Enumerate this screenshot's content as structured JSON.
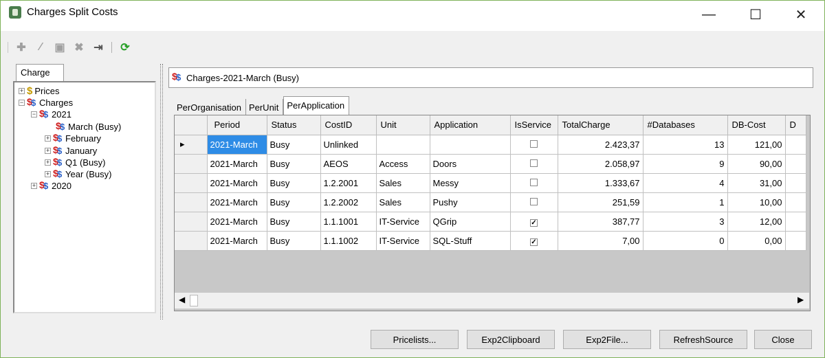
{
  "window": {
    "title": "Charges Split Costs",
    "minimize": "—",
    "maximize": "☐",
    "close": "✕"
  },
  "toolbar": {
    "icons": [
      "add-icon",
      "edit-icon",
      "save-icon",
      "delete-icon",
      "export-icon",
      "refresh-icon"
    ]
  },
  "left_panel": {
    "tab": "Charge",
    "tree": {
      "prices": "Prices",
      "charges": "Charges",
      "y2021": "2021",
      "march": "March (Busy)",
      "february": "February",
      "january": "January",
      "q1": "Q1 (Busy)",
      "year": "Year (Busy)",
      "y2020": "2020"
    }
  },
  "header": {
    "title": "Charges-2021-March (Busy)"
  },
  "tabs": [
    "PerOrganisation",
    "PerUnit",
    "PerApplication"
  ],
  "grid": {
    "columns": [
      "Period",
      "Status",
      "CostID",
      "Unit",
      "Application",
      "IsService",
      "TotalCharge",
      "#Databases",
      "DB-Cost",
      "D"
    ],
    "rows": [
      {
        "period": "2021-March",
        "status": "Busy",
        "costid": "Unlinked",
        "unit": "",
        "application": "",
        "isservice": "",
        "totalcharge": "2.423,37",
        "databases": "13",
        "dbcost": "121,00"
      },
      {
        "period": "2021-March",
        "status": "Busy",
        "costid": "AEOS",
        "unit": "Access",
        "application": "Doors",
        "isservice": "",
        "totalcharge": "2.058,97",
        "databases": "9",
        "dbcost": "90,00"
      },
      {
        "period": "2021-March",
        "status": "Busy",
        "costid": "1.2.2001",
        "unit": "Sales",
        "application": "Messy",
        "isservice": "",
        "totalcharge": "1.333,67",
        "databases": "4",
        "dbcost": "31,00"
      },
      {
        "period": "2021-March",
        "status": "Busy",
        "costid": "1.2.2002",
        "unit": "Sales",
        "application": "Pushy",
        "isservice": "",
        "totalcharge": "251,59",
        "databases": "1",
        "dbcost": "10,00"
      },
      {
        "period": "2021-March",
        "status": "Busy",
        "costid": "1.1.1001",
        "unit": "IT-Service",
        "application": "QGrip",
        "isservice": "✓",
        "totalcharge": "387,77",
        "databases": "3",
        "dbcost": "12,00"
      },
      {
        "period": "2021-March",
        "status": "Busy",
        "costid": "1.1.1002",
        "unit": "IT-Service",
        "application": "SQL-Stuff",
        "isservice": "✓",
        "totalcharge": "7,00",
        "databases": "0",
        "dbcost": "0,00"
      }
    ]
  },
  "buttons": {
    "pricelists": "Pricelists...",
    "exp2clipboard": "Exp2Clipboard",
    "exp2file": "Exp2File...",
    "refreshsource": "RefreshSource",
    "close": "Close"
  }
}
